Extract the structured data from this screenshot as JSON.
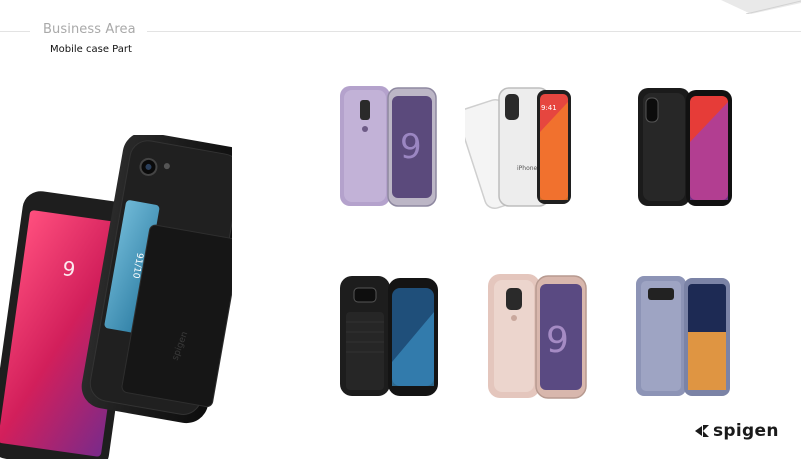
{
  "header": {
    "section_title": "Business Area",
    "section_subtitle": "Mobile case Part"
  },
  "hero_phone": {
    "name": "card-slot-case-phone",
    "screen_time": "9",
    "card_text": "91/10"
  },
  "products": [
    {
      "name": "lavender-clear-case-galaxy",
      "screen_text": "9"
    },
    {
      "name": "clear-case-iphone-x",
      "screen_text": "9:41"
    },
    {
      "name": "black-bumper-case-iphone-x",
      "screen_text": ""
    },
    {
      "name": "black-rugged-case-galaxy-s7",
      "screen_text": ""
    },
    {
      "name": "pink-case-galaxy-s9-plus",
      "screen_text": "9"
    },
    {
      "name": "lavender-case-galaxy-note-8",
      "screen_text": ""
    }
  ],
  "brand": {
    "logo_text": "spigen"
  },
  "colors": {
    "accent_gray": "#a9a9a9",
    "lavender": "#b4a2cc",
    "pink": "#e4c6bd",
    "note_lavender": "#8d94b6",
    "case_black": "#1b1b1b"
  }
}
